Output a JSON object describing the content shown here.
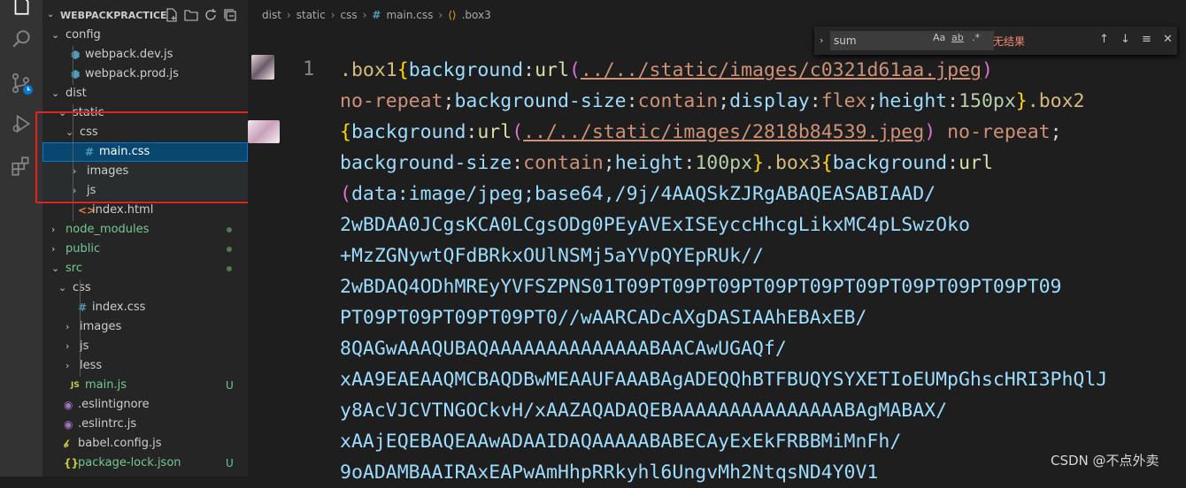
{
  "explorer": {
    "title": "WEBPACKPRACTICE",
    "rows": [
      {
        "label": "config",
        "chev": "⌄",
        "icon": "",
        "color": "#cccccc",
        "badge": ""
      },
      {
        "label": "webpack.dev.js",
        "chev": "",
        "icon": "⬢",
        "color": "#cccccc",
        "badge": ""
      },
      {
        "label": "webpack.prod.js",
        "chev": "",
        "icon": "⬢",
        "color": "#cccccc",
        "badge": ""
      },
      {
        "label": "dist",
        "chev": "⌄",
        "icon": "",
        "color": "#cccccc",
        "badge": ""
      },
      {
        "label": "static",
        "chev": "⌄",
        "icon": "",
        "color": "#cccccc",
        "badge": ""
      },
      {
        "label": "css",
        "chev": "⌄",
        "icon": "",
        "color": "#cccccc",
        "badge": ""
      },
      {
        "label": "main.css",
        "chev": "",
        "icon": "#",
        "color": "#ffffff",
        "badge": ""
      },
      {
        "label": "images",
        "chev": "›",
        "icon": "",
        "color": "#cccccc",
        "badge": ""
      },
      {
        "label": "js",
        "chev": "›",
        "icon": "",
        "color": "#cccccc",
        "badge": ""
      },
      {
        "label": "index.html",
        "chev": "",
        "icon": "<>",
        "color": "#cccccc",
        "badge": ""
      },
      {
        "label": "node_modules",
        "chev": "›",
        "icon": "",
        "color": "#73c991",
        "badge": "dot"
      },
      {
        "label": "public",
        "chev": "›",
        "icon": "",
        "color": "#73c991",
        "badge": "dot"
      },
      {
        "label": "src",
        "chev": "⌄",
        "icon": "",
        "color": "#73c991",
        "badge": "dot"
      },
      {
        "label": "css",
        "chev": "⌄",
        "icon": "",
        "color": "#cccccc",
        "badge": ""
      },
      {
        "label": "index.css",
        "chev": "",
        "icon": "#",
        "color": "#cccccc",
        "badge": ""
      },
      {
        "label": "images",
        "chev": "›",
        "icon": "",
        "color": "#cccccc",
        "badge": ""
      },
      {
        "label": "js",
        "chev": "›",
        "icon": "",
        "color": "#cccccc",
        "badge": ""
      },
      {
        "label": "less",
        "chev": "›",
        "icon": "",
        "color": "#cccccc",
        "badge": ""
      },
      {
        "label": "main.js",
        "chev": "",
        "icon": "JS",
        "color": "#73c991",
        "badge": "U"
      },
      {
        "label": ".eslintignore",
        "chev": "",
        "icon": "◉",
        "color": "#cccccc",
        "badge": ""
      },
      {
        "label": ".eslintrc.js",
        "chev": "",
        "icon": "◉",
        "color": "#cccccc",
        "badge": ""
      },
      {
        "label": "babel.config.js",
        "chev": "",
        "icon": "𝒷",
        "color": "#cccccc",
        "badge": ""
      },
      {
        "label": "package-lock.json",
        "chev": "",
        "icon": "{}",
        "color": "#73c991",
        "badge": "U"
      }
    ]
  },
  "breadcrumb": {
    "parts": [
      "dist",
      "static",
      "css"
    ],
    "file": "main.css",
    "symbol": ".box3",
    "file_icon": "#",
    "symbol_icon": "⟨⟩"
  },
  "find": {
    "query": "sum",
    "match_case": "Aa",
    "whole_word": "ab",
    "regex": ".*",
    "result": "无结果"
  },
  "editor": {
    "line_number": "1",
    "code": {
      "sel1": ".box1",
      "bg1_prop": "background",
      "url1": "../../static/images/c0321d61aa.jpeg",
      "norepeat": "no-repeat",
      "bgsize_prop": "background-size",
      "contain": "contain",
      "display_prop": "display",
      "flex": "flex",
      "height_prop": "height",
      "h1": "150px",
      "sel2": ".box2",
      "url2": "../../static/images/2818b84539.jpeg",
      "h2": "100px",
      "sel3": ".box3",
      "url_fn": "url",
      "data_lines": [
        "data:image/jpeg;base64,/9j/4AAQSkZJRgABAQEASABIAAD/",
        "2wBDAA0JCgsKCA0LCgsODg0PEyAVExISEyccHhcgLikxMC4pLSwzOko",
        "+MzZGNywtQFdBRkxOUlNSMj5aYVpQYEpRUk//",
        "2wBDAQ4ODhMREyYVFSZPNS01T09PT09PT09PT09PT09PT09PT09PT09PT09PT09",
        "PT09PT09PT09PT09PT0//wAARCADcAXgDASIAAhEBAxEB/",
        "8QAGwAAAQUBAQAAAAAAAAAAAAAABAACAwUGAQf/",
        "xAA9EAEAAQMCBAQDBwMEAAUFAAABAgADEQQhBTFBUQYSYXETIoEUMpGhscHRI3PhQlJ",
        "y8AcVJCVTNGOCkvH/xAAZAQADAQEBAAAAAAAAAAAAAAABAgMABAX/",
        "xAAjEQEBAQEAAwADAAIDAQAAAAABABECAyExEkFRBBMiMnFh/",
        "9oADAMBAAIRAxEAPwAmHhpRRkyhl6UngvMh2NtqsND4Y0V1"
      ]
    }
  },
  "watermark": "CSDN @不点外卖"
}
